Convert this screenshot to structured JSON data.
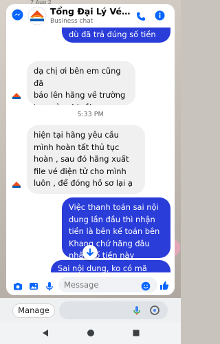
{
  "status_strip": {
    "text": "7 Aug 2"
  },
  "header": {
    "title": "Tổng Đại Lý Vé M...",
    "subtitle": "Business chat"
  },
  "messages": [
    {
      "id": 1,
      "direction": "outgoing",
      "text": "xuất vé cho khách mặc\ndù đã trả đúng số tiền"
    },
    {
      "id": 2,
      "direction": "incoming",
      "text": "dạ chị ơi bên em cũng đã\nbáo lên hãng về trường\nhợp của chị rồi"
    },
    {
      "id": 3,
      "direction": "timestamp",
      "text": "5:33 PM"
    },
    {
      "id": 4,
      "direction": "incoming",
      "text": "hiện tại hãng yêu cầu\nmình hoàn tất thủ tục\nhoàn , sau đó hãng xuất\nfile vé điện tử cho mình\nluôn , để đóng hồ sơ lại ạ"
    },
    {
      "id": 5,
      "direction": "outgoing",
      "text": "Việc thanh toán sai nội\ndung lần đầu thì nhận\ntiền là bên kế toán bên\nKhang chứ hãng đâu\nnhận số tiền này"
    },
    {
      "id": 6,
      "direction": "outgoing",
      "text": "Sai nội dung, ko có mã"
    }
  ],
  "composer": {
    "placeholder": "Message"
  },
  "keyboard": {
    "manage_label": "Manage"
  },
  "colors": {
    "outgoing_bubble": "#2a3dd8",
    "accent": "#0866ff",
    "incoming_bubble": "#f0f0f0"
  },
  "icons": [
    "messenger-icon",
    "phone-icon",
    "info-icon",
    "camera-icon",
    "image-icon",
    "mic-icon",
    "emoji-icon",
    "like-icon",
    "arrow-down-icon",
    "search-icon",
    "back-icon",
    "home-icon",
    "recents-icon"
  ]
}
